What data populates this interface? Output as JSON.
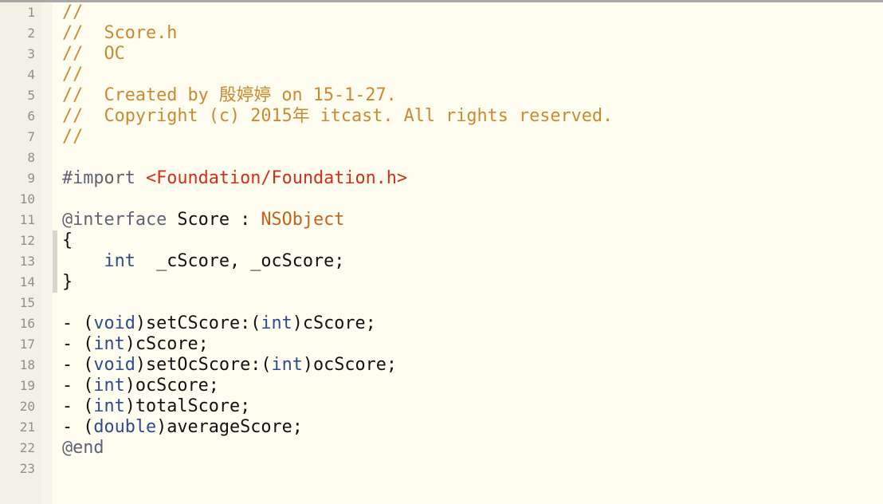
{
  "editor": {
    "file_name": "Score.h",
    "colors": {
      "comment": "#c98a32",
      "keyword": "#2f4a8e",
      "directive": "#5f6376",
      "string": "#d12f1b",
      "class": "#c0641c",
      "background": "#fffdf0"
    },
    "lines": [
      {
        "n": "1",
        "tokens": [
          {
            "t": "comment",
            "v": "//"
          }
        ]
      },
      {
        "n": "2",
        "tokens": [
          {
            "t": "comment",
            "v": "//  Score.h"
          }
        ]
      },
      {
        "n": "3",
        "tokens": [
          {
            "t": "comment",
            "v": "//  OC"
          }
        ]
      },
      {
        "n": "4",
        "tokens": [
          {
            "t": "comment",
            "v": "//"
          }
        ]
      },
      {
        "n": "5",
        "tokens": [
          {
            "t": "comment",
            "v": "//  Created by 殷婷婷 on 15-1-27."
          }
        ]
      },
      {
        "n": "6",
        "tokens": [
          {
            "t": "comment",
            "v": "//  Copyright (c) 2015年 itcast. All rights reserved."
          }
        ]
      },
      {
        "n": "7",
        "tokens": [
          {
            "t": "comment",
            "v": "//"
          }
        ]
      },
      {
        "n": "8",
        "tokens": []
      },
      {
        "n": "9",
        "tokens": [
          {
            "t": "directive",
            "v": "#import "
          },
          {
            "t": "string",
            "v": "<Foundation/Foundation.h>"
          }
        ]
      },
      {
        "n": "10",
        "tokens": []
      },
      {
        "n": "11",
        "tokens": [
          {
            "t": "directive",
            "v": "@interface"
          },
          {
            "t": "plain",
            "v": " Score : "
          },
          {
            "t": "class",
            "v": "NSObject"
          }
        ]
      },
      {
        "n": "12",
        "tokens": [
          {
            "t": "plain",
            "v": "{"
          }
        ]
      },
      {
        "n": "13",
        "tokens": [
          {
            "t": "plain",
            "v": "    "
          },
          {
            "t": "keyword",
            "v": "int"
          },
          {
            "t": "plain",
            "v": "  _cScore, _ocScore;"
          }
        ]
      },
      {
        "n": "14",
        "tokens": [
          {
            "t": "plain",
            "v": "}"
          }
        ]
      },
      {
        "n": "15",
        "tokens": []
      },
      {
        "n": "16",
        "tokens": [
          {
            "t": "plain",
            "v": "- ("
          },
          {
            "t": "keyword",
            "v": "void"
          },
          {
            "t": "plain",
            "v": ")setCScore:("
          },
          {
            "t": "keyword",
            "v": "int"
          },
          {
            "t": "plain",
            "v": ")cScore;"
          }
        ]
      },
      {
        "n": "17",
        "tokens": [
          {
            "t": "plain",
            "v": "- ("
          },
          {
            "t": "keyword",
            "v": "int"
          },
          {
            "t": "plain",
            "v": ")cScore;"
          }
        ]
      },
      {
        "n": "18",
        "tokens": [
          {
            "t": "plain",
            "v": "- ("
          },
          {
            "t": "keyword",
            "v": "void"
          },
          {
            "t": "plain",
            "v": ")setOcScore:("
          },
          {
            "t": "keyword",
            "v": "int"
          },
          {
            "t": "plain",
            "v": ")ocScore;"
          }
        ]
      },
      {
        "n": "19",
        "tokens": [
          {
            "t": "plain",
            "v": "- ("
          },
          {
            "t": "keyword",
            "v": "int"
          },
          {
            "t": "plain",
            "v": ")ocScore;"
          }
        ]
      },
      {
        "n": "20",
        "tokens": [
          {
            "t": "plain",
            "v": "- ("
          },
          {
            "t": "keyword",
            "v": "int"
          },
          {
            "t": "plain",
            "v": ")totalScore;"
          }
        ]
      },
      {
        "n": "21",
        "tokens": [
          {
            "t": "plain",
            "v": "- ("
          },
          {
            "t": "keyword",
            "v": "double"
          },
          {
            "t": "plain",
            "v": ")averageScore;"
          }
        ]
      },
      {
        "n": "22",
        "tokens": [
          {
            "t": "directive",
            "v": "@end"
          }
        ]
      },
      {
        "n": "23",
        "tokens": []
      }
    ]
  }
}
